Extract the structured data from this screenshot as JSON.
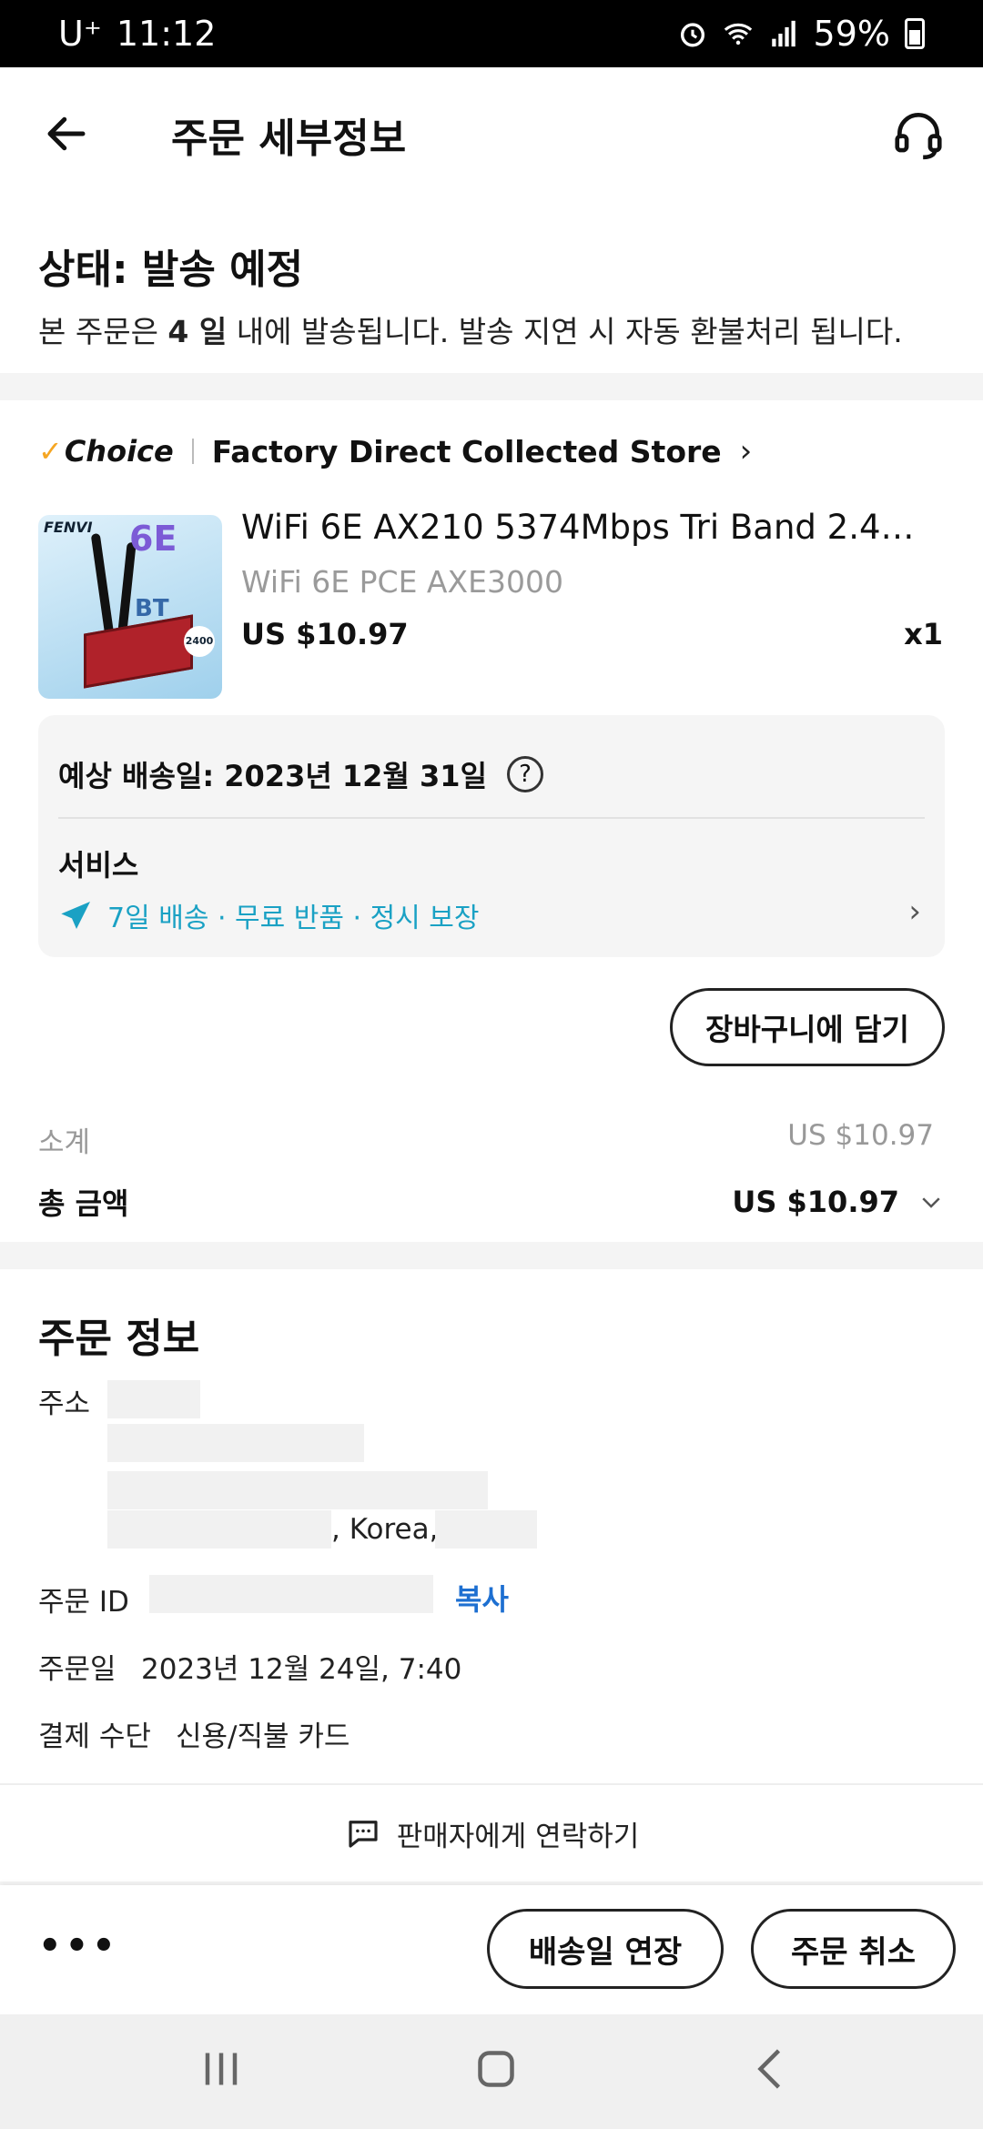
{
  "status_bar": {
    "carrier": "U⁺",
    "time": "11:12",
    "battery": "59%"
  },
  "header": {
    "title": "주문 세부정보"
  },
  "status": {
    "title": "상태: 발송 예정",
    "desc_prefix": "본 주문은 ",
    "desc_days": "4 일",
    "desc_suffix": " 내에 발송됩니다. 발송 지연 시 자동 환불처리 됩니다."
  },
  "store": {
    "choice_label": "Choice",
    "name": "Factory Direct Collected Store"
  },
  "product": {
    "title": "WiFi 6E AX210 5374Mbps Tri Band 2.4G/...",
    "variant": "WiFi 6E PCE AXE3000",
    "price": "US $10.97",
    "qty": "x1",
    "thumb_brand": "FENVI",
    "thumb_wifi": "6E",
    "thumb_bt": "BT",
    "thumb_badge": "2400"
  },
  "delivery": {
    "eta": "예상 배송일: 2023년 12월 31일",
    "service_label": "서비스",
    "service_text": "7일 배송 · 무료 반품 · 정시 보장"
  },
  "cart_button": "장바구니에 담기",
  "summary": {
    "subtotal_label": "소계",
    "subtotal": "US $10.97",
    "total_label": "총 금액",
    "total": "US $10.97"
  },
  "order_info": {
    "title": "주문 정보",
    "address_label": "주소",
    "address_country": ", Korea,",
    "order_id_label": "주문 ID",
    "copy_label": "복사",
    "order_date_label": "주문일",
    "order_date": "2023년 12월 24일, 7:40",
    "payment_label": "결제 수단",
    "payment": "신용/직불 카드"
  },
  "contact_seller": "판매자에게 연락하기",
  "bottom": {
    "more": "•••",
    "extend": "배송일 연장",
    "cancel": "주문 취소"
  },
  "colors": {
    "accent_link": "#1d6fd1",
    "service": "#1aa1c4",
    "choice_check": "#f5a623"
  },
  "icons": [
    "back-arrow-icon",
    "headset-icon",
    "help-icon",
    "plane-icon",
    "chat-icon",
    "chevron-right-icon",
    "chevron-down-icon",
    "recents-icon",
    "home-icon",
    "back-nav-icon"
  ]
}
